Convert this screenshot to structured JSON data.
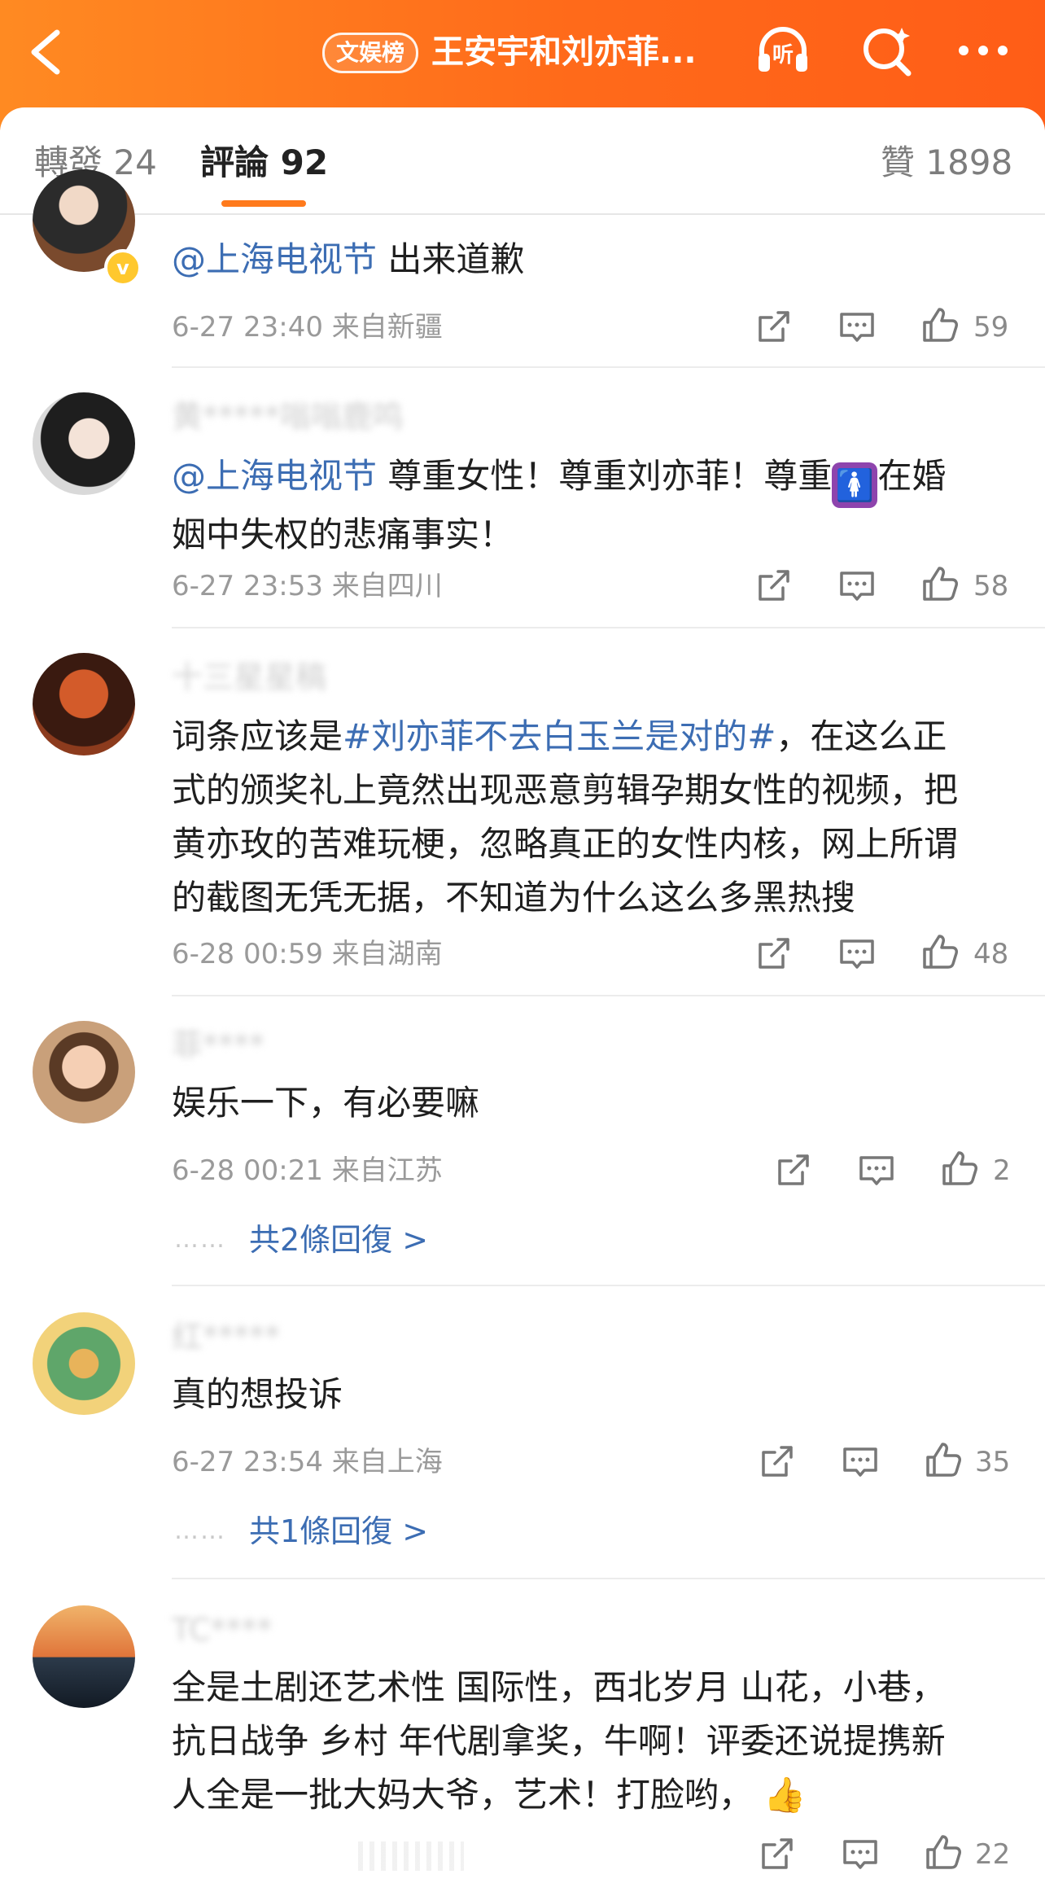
{
  "header": {
    "back_icon": "chevron-left-icon",
    "badge": "文娱榜",
    "title": "王安宇和刘亦菲...",
    "listen_icon": "headphones-icon",
    "listen_label": "听",
    "search_icon": "search-sparkle-icon",
    "more_icon": "more-dots-icon",
    "accent_color": "#ff6a1a"
  },
  "tabs": {
    "repost": "轉發 24",
    "comments": "評論 92",
    "likes": "贊 1898",
    "active": "comments",
    "underline_color": "#ff7a1c"
  },
  "comments": [
    {
      "verified": true,
      "mention": "@上海电视节",
      "text": " 出来道歉",
      "time": "6-27 23:40",
      "location": "来自新疆",
      "likes": "59"
    },
    {
      "username": "黄*****嗡嗡鹿鸣",
      "mention": "@上海电视节",
      "text_line1": " 尊重女性！尊重刘亦菲！尊重",
      "emoji": "🚺",
      "text_line1_end": "在婚",
      "text_line2": "姻中失权的悲痛事实！",
      "time": "6-27 23:53",
      "location": "来自四川",
      "likes": "58"
    },
    {
      "username": "十三星星稿",
      "prefix": "词条应该是",
      "hashtag": "#刘亦菲不去白玉兰是对的#",
      "line1_end": "，在这么正",
      "line2": "式的颁奖礼上竟然出现恶意剪辑孕期女性的视频，把",
      "line3": "黄亦玫的苦难玩梗，忽略真正的女性内核，网上所谓",
      "line4": "的截图无凭无据，不知道为什么这么多黑热搜",
      "time": "6-28 00:59",
      "location": "来自湖南",
      "likes": "48"
    },
    {
      "username": "菲****",
      "text": "娱乐一下，有必要嘛",
      "time": "6-28 00:21",
      "location": "来自江苏",
      "likes": "2",
      "replies_dots": "……",
      "replies": "共2條回復 >"
    },
    {
      "username": "红*****",
      "text": "真的想投诉",
      "time": "6-27 23:54",
      "location": "来自上海",
      "likes": "35",
      "replies_dots": "……",
      "replies": "共1條回復 >"
    },
    {
      "username": "TC****",
      "line1": "全是土剧还艺术性 国际性，西北岁月 山花，小巷，",
      "line2": "抗日战争 乡村 年代剧拿奖，牛啊！评委还说提携新",
      "line3": "人全是一批大妈大爷，艺术！打脸哟，",
      "emoji": "👍",
      "likes": "22"
    }
  ],
  "icons": {
    "share": "share-icon",
    "reply": "comment-icon",
    "like": "thumbs-up-icon"
  }
}
